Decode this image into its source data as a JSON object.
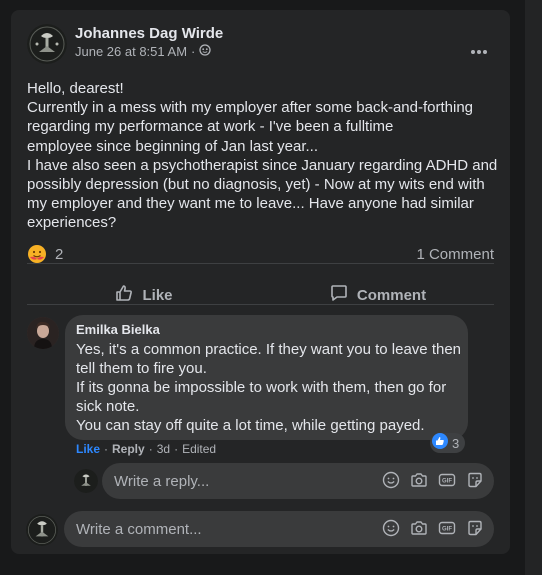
{
  "post": {
    "author": "Johannes Dag Wirde",
    "timestamp": "June 26 at 8:51 AM",
    "separator": "·",
    "body": "Hello, dearest!\nCurrently in a mess with my employer after some back-and-forthing regarding my performance at work - I've been a fulltime\n employee since beginning of Jan last year...\nI have also seen a psychotherapist since January regarding ADHD and possibly depression (but no diagnosis, yet) - Now at my wits end with my employer and they want me to leave... Have anyone had similar experiences?",
    "reaction_count": "2",
    "comment_count": "1 Comment"
  },
  "actions": {
    "like": "Like",
    "comment": "Comment"
  },
  "comment": {
    "author": "Emilka Bielka",
    "text": "Yes, it's a common practice. If they want you to leave then tell them to fire you.\nIf its gonna be impossible to work with them, then go for sick note.\nYou can stay off quite a lot time, while getting payed.",
    "reaction_count": "3",
    "like_link": "Like",
    "reply_link": "Reply",
    "age": "3d",
    "edited": "Edited",
    "dot": "·"
  },
  "reply_input": {
    "placeholder": "Write a reply..."
  },
  "comment_input": {
    "placeholder": "Write a comment..."
  },
  "colors": {
    "accent": "#2d88ff",
    "background": "#18191a",
    "card": "#242526",
    "bubble": "#3a3b3c"
  },
  "icons": [
    "globe-icon",
    "more-icon",
    "hug-reaction-icon",
    "like-icon",
    "comment-icon",
    "emoji-icon",
    "camera-icon",
    "gif-icon",
    "sticker-icon"
  ]
}
